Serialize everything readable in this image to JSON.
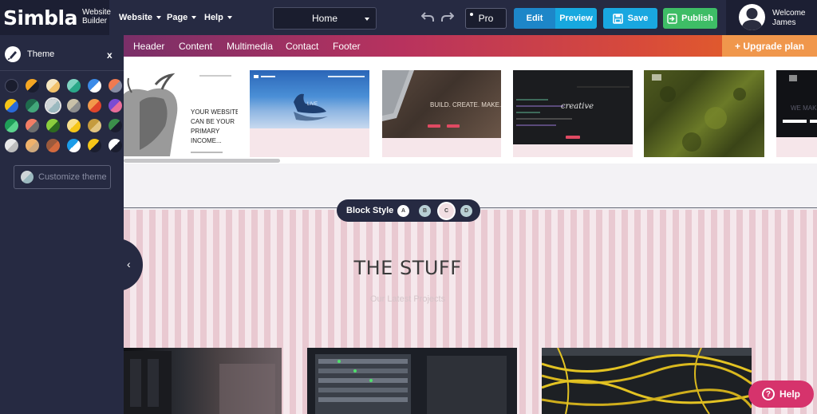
{
  "brand": {
    "name": "Simbla",
    "subtitle_line1": "Website",
    "subtitle_line2": "Builder"
  },
  "menus": [
    {
      "label": "Website"
    },
    {
      "label": "Page"
    },
    {
      "label": "Help"
    }
  ],
  "page_select": {
    "value": "Home"
  },
  "pro_label": "Pro",
  "mode": {
    "edit": "Edit",
    "preview": "Preview",
    "active": "Edit"
  },
  "save_label": "Save",
  "publish_label": "Publish",
  "user": {
    "welcome": "Welcome",
    "name": "James"
  },
  "sidebar": {
    "title": "Theme",
    "close": "x",
    "customize_label": "Customize theme",
    "swatches": [
      [
        "#1a1d2e",
        "#1a1d2e"
      ],
      [
        "#f5a623",
        "#1a1d2e"
      ],
      [
        "#f6e7c1",
        "#f2c26b"
      ],
      [
        "#7fd3c1",
        "#2aa889"
      ],
      [
        "#3b8be8",
        "#ffffff"
      ],
      [
        "#f07a50",
        "#8a8ea4"
      ],
      [
        "#f5c518",
        "#2a6ad8"
      ],
      [
        "#1f6b4d",
        "#43a77a"
      ],
      [
        "#cfd6d8",
        "#9bb9bf"
      ],
      [
        "#c9c0a8",
        "#8e8e8e"
      ],
      [
        "#f2994a",
        "#e0452b"
      ],
      [
        "#7b4bd3",
        "#e96d9a"
      ],
      [
        "#1f9e58",
        "#5bd28d"
      ],
      [
        "#f27d65",
        "#6e6e6e"
      ],
      [
        "#8ccf3e",
        "#2d6b1f"
      ],
      [
        "#f8e08e",
        "#f5c518"
      ],
      [
        "#c59b3e",
        "#e3c580"
      ],
      [
        "#3b8e4a",
        "#1a1d2e"
      ],
      [
        "#e8e8e8",
        "#bdbdbd"
      ],
      [
        "#f0b26b",
        "#cfa97d"
      ],
      [
        "#9b5a3c",
        "#d26a3e"
      ],
      [
        "#1b9ce8",
        "#ffffff"
      ],
      [
        "#f5c518",
        "#1a1d2e"
      ],
      [
        "#ffffff",
        "#1a1d2e"
      ]
    ]
  },
  "categories": [
    "Header",
    "Content",
    "Multimedia",
    "Contact",
    "Footer"
  ],
  "upgrade_label": "+ Upgrade plan",
  "templates": [
    {
      "name": "bull"
    },
    {
      "name": "lake"
    },
    {
      "name": "laptop"
    },
    {
      "name": "code"
    },
    {
      "name": "moss"
    },
    {
      "name": "dark"
    }
  ],
  "block_style": {
    "label": "Block Style",
    "options": [
      "A",
      "B",
      "C",
      "D"
    ],
    "selected": "C"
  },
  "section": {
    "title": "THE STUFF",
    "subtitle": "Our Latest Projects"
  },
  "help_label": "Help",
  "colors": {
    "accent": "#19a7e0",
    "publish": "#3ebd66",
    "help": "#d6336c",
    "upgrade": "#f0974c"
  }
}
